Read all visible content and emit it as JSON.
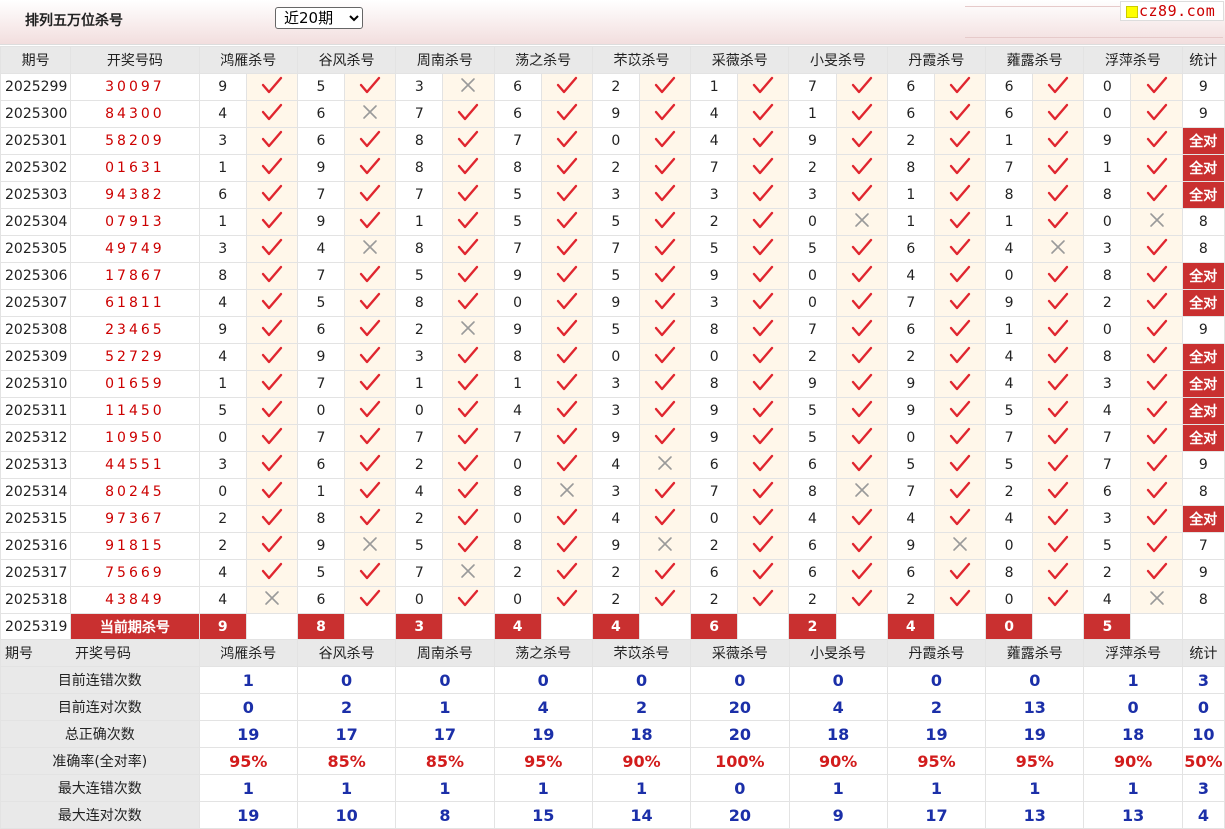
{
  "title": "排列五万位杀号",
  "select": {
    "value": "近20期",
    "options": [
      "近20期"
    ]
  },
  "logo": "cz89.com",
  "headers": [
    "期号",
    "开奖号码",
    "鸿雁杀号",
    "谷风杀号",
    "周南杀号",
    "荡之杀号",
    "芣苡杀号",
    "采薇杀号",
    "小旻杀号",
    "丹霞杀号",
    "蕹露杀号",
    "浮萍杀号",
    "统计"
  ],
  "rows": [
    {
      "issue": "2025299",
      "draw": "30097",
      "kills": [
        9,
        5,
        3,
        6,
        2,
        1,
        7,
        6,
        6,
        0
      ],
      "ok": [
        1,
        1,
        0,
        1,
        1,
        1,
        1,
        1,
        1,
        1
      ],
      "count": "9"
    },
    {
      "issue": "2025300",
      "draw": "84300",
      "kills": [
        4,
        6,
        7,
        6,
        9,
        4,
        1,
        6,
        6,
        0
      ],
      "ok": [
        1,
        0,
        1,
        1,
        1,
        1,
        1,
        1,
        1,
        1
      ],
      "count": "9"
    },
    {
      "issue": "2025301",
      "draw": "58209",
      "kills": [
        3,
        6,
        8,
        7,
        0,
        4,
        9,
        2,
        1,
        9
      ],
      "ok": [
        1,
        1,
        1,
        1,
        1,
        1,
        1,
        1,
        1,
        1
      ],
      "count": "全对"
    },
    {
      "issue": "2025302",
      "draw": "01631",
      "kills": [
        1,
        9,
        8,
        8,
        2,
        7,
        2,
        8,
        7,
        1
      ],
      "ok": [
        1,
        1,
        1,
        1,
        1,
        1,
        1,
        1,
        1,
        1
      ],
      "count": "全对"
    },
    {
      "issue": "2025303",
      "draw": "94382",
      "kills": [
        6,
        7,
        7,
        5,
        3,
        3,
        3,
        1,
        8,
        8
      ],
      "ok": [
        1,
        1,
        1,
        1,
        1,
        1,
        1,
        1,
        1,
        1
      ],
      "count": "全对"
    },
    {
      "issue": "2025304",
      "draw": "07913",
      "kills": [
        1,
        9,
        1,
        5,
        5,
        2,
        0,
        1,
        1,
        0
      ],
      "ok": [
        1,
        1,
        1,
        1,
        1,
        1,
        0,
        1,
        1,
        0
      ],
      "count": "8"
    },
    {
      "issue": "2025305",
      "draw": "49749",
      "kills": [
        3,
        4,
        8,
        7,
        7,
        5,
        5,
        6,
        4,
        3
      ],
      "ok": [
        1,
        0,
        1,
        1,
        1,
        1,
        1,
        1,
        0,
        1
      ],
      "count": "8"
    },
    {
      "issue": "2025306",
      "draw": "17867",
      "kills": [
        8,
        7,
        5,
        9,
        5,
        9,
        0,
        4,
        0,
        8
      ],
      "ok": [
        1,
        1,
        1,
        1,
        1,
        1,
        1,
        1,
        1,
        1
      ],
      "count": "全对"
    },
    {
      "issue": "2025307",
      "draw": "61811",
      "kills": [
        4,
        5,
        8,
        0,
        9,
        3,
        0,
        7,
        9,
        2
      ],
      "ok": [
        1,
        1,
        1,
        1,
        1,
        1,
        1,
        1,
        1,
        1
      ],
      "count": "全对"
    },
    {
      "issue": "2025308",
      "draw": "23465",
      "kills": [
        9,
        6,
        2,
        9,
        5,
        8,
        7,
        6,
        1,
        0
      ],
      "ok": [
        1,
        1,
        0,
        1,
        1,
        1,
        1,
        1,
        1,
        1
      ],
      "count": "9"
    },
    {
      "issue": "2025309",
      "draw": "52729",
      "kills": [
        4,
        9,
        3,
        8,
        0,
        0,
        2,
        2,
        4,
        8
      ],
      "ok": [
        1,
        1,
        1,
        1,
        1,
        1,
        1,
        1,
        1,
        1
      ],
      "count": "全对"
    },
    {
      "issue": "2025310",
      "draw": "01659",
      "kills": [
        1,
        7,
        1,
        1,
        3,
        8,
        9,
        9,
        4,
        3
      ],
      "ok": [
        1,
        1,
        1,
        1,
        1,
        1,
        1,
        1,
        1,
        1
      ],
      "count": "全对"
    },
    {
      "issue": "2025311",
      "draw": "11450",
      "kills": [
        5,
        0,
        0,
        4,
        3,
        9,
        5,
        9,
        5,
        4
      ],
      "ok": [
        1,
        1,
        1,
        1,
        1,
        1,
        1,
        1,
        1,
        1
      ],
      "count": "全对"
    },
    {
      "issue": "2025312",
      "draw": "10950",
      "kills": [
        0,
        7,
        7,
        7,
        9,
        9,
        5,
        0,
        7,
        7
      ],
      "ok": [
        1,
        1,
        1,
        1,
        1,
        1,
        1,
        1,
        1,
        1
      ],
      "count": "全对"
    },
    {
      "issue": "2025313",
      "draw": "44551",
      "kills": [
        3,
        6,
        2,
        0,
        4,
        6,
        6,
        5,
        5,
        7
      ],
      "ok": [
        1,
        1,
        1,
        1,
        0,
        1,
        1,
        1,
        1,
        1
      ],
      "count": "9"
    },
    {
      "issue": "2025314",
      "draw": "80245",
      "kills": [
        0,
        1,
        4,
        8,
        3,
        7,
        8,
        7,
        2,
        6
      ],
      "ok": [
        1,
        1,
        1,
        0,
        1,
        1,
        0,
        1,
        1,
        1
      ],
      "count": "8"
    },
    {
      "issue": "2025315",
      "draw": "97367",
      "kills": [
        2,
        8,
        2,
        0,
        4,
        0,
        4,
        4,
        4,
        3
      ],
      "ok": [
        1,
        1,
        1,
        1,
        1,
        1,
        1,
        1,
        1,
        1
      ],
      "count": "全对"
    },
    {
      "issue": "2025316",
      "draw": "91815",
      "kills": [
        2,
        9,
        5,
        8,
        9,
        2,
        6,
        9,
        0,
        5
      ],
      "ok": [
        1,
        0,
        1,
        1,
        0,
        1,
        1,
        0,
        1,
        1
      ],
      "count": "7"
    },
    {
      "issue": "2025317",
      "draw": "75669",
      "kills": [
        4,
        5,
        7,
        2,
        2,
        6,
        6,
        6,
        8,
        2
      ],
      "ok": [
        1,
        1,
        0,
        1,
        1,
        1,
        1,
        1,
        1,
        1
      ],
      "count": "9"
    },
    {
      "issue": "2025318",
      "draw": "43849",
      "kills": [
        4,
        6,
        0,
        0,
        2,
        2,
        2,
        2,
        0,
        4
      ],
      "ok": [
        0,
        1,
        1,
        1,
        1,
        1,
        1,
        1,
        1,
        0
      ],
      "count": "8"
    }
  ],
  "current": {
    "issue": "2025319",
    "label": "当前期杀号",
    "kills": [
      "9",
      "8",
      "3",
      "4",
      "4",
      "6",
      "2",
      "4",
      "0",
      "5"
    ]
  },
  "stats": [
    {
      "label": "目前连错次数",
      "values": [
        "1",
        "0",
        "0",
        "0",
        "0",
        "0",
        "0",
        "0",
        "0",
        "1"
      ],
      "total": "3"
    },
    {
      "label": "目前连对次数",
      "values": [
        "0",
        "2",
        "1",
        "4",
        "2",
        "20",
        "4",
        "2",
        "13",
        "0"
      ],
      "total": "0"
    },
    {
      "label": "总正确次数",
      "values": [
        "19",
        "17",
        "17",
        "19",
        "18",
        "20",
        "18",
        "19",
        "19",
        "18"
      ],
      "total": "10"
    },
    {
      "label": "准确率(全对率)",
      "values": [
        "95%",
        "85%",
        "85%",
        "95%",
        "90%",
        "100%",
        "90%",
        "95%",
        "95%",
        "90%"
      ],
      "total": "50%"
    },
    {
      "label": "最大连错次数",
      "values": [
        "1",
        "1",
        "1",
        "1",
        "1",
        "0",
        "1",
        "1",
        "1",
        "1"
      ],
      "total": "3"
    },
    {
      "label": "最大连对次数",
      "values": [
        "19",
        "10",
        "8",
        "15",
        "14",
        "20",
        "9",
        "17",
        "13",
        "13"
      ],
      "total": "4"
    }
  ],
  "colors": {
    "accent": "#c93030",
    "tick": "#e0262f",
    "cross": "#999999",
    "stat_blue": "#1b2fa8",
    "stat_red": "#d21c1c"
  }
}
